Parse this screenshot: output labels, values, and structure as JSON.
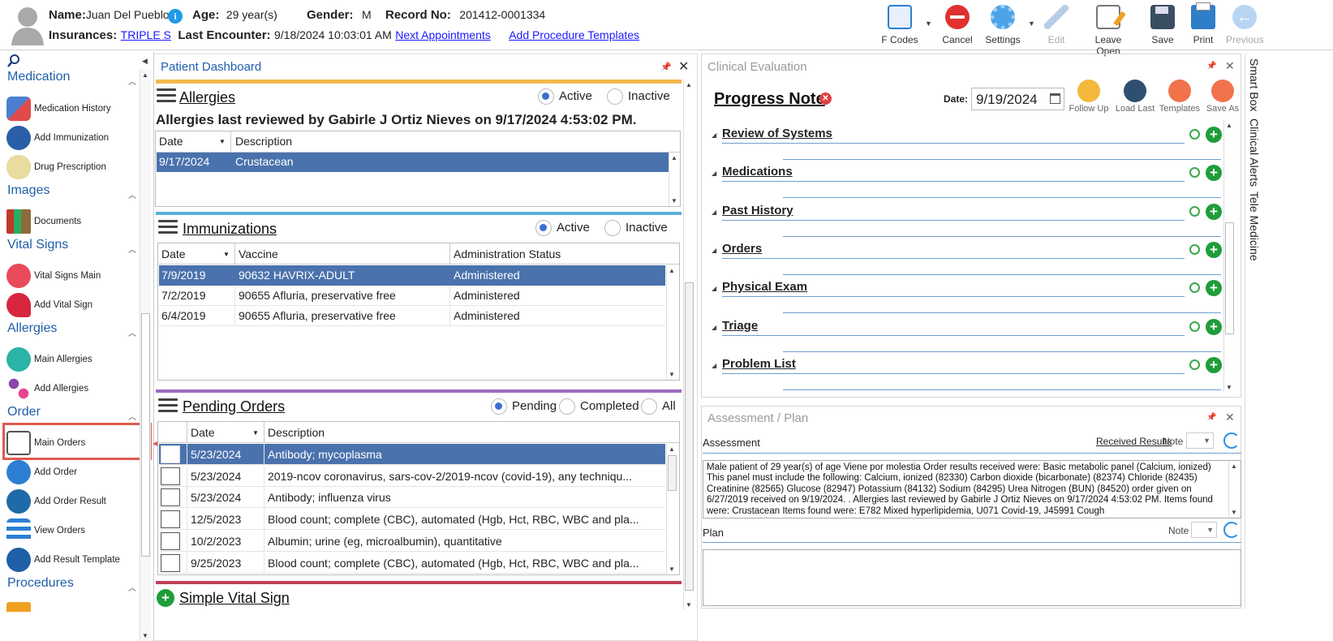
{
  "patient": {
    "name_label": "Name:",
    "name": "Juan Del Pueblo",
    "age_label": "Age:",
    "age": "29 year(s)",
    "gender_label": "Gender:",
    "gender": "M",
    "record_label": "Record No:",
    "record": "201412-0001334",
    "insurances_label": "Insurances:",
    "insurance": "TRIPLE S",
    "last_encounter_label": "Last Encounter:",
    "last_encounter": "9/18/2024 10:03:01 AM",
    "next_appointments": "Next Appointments",
    "add_procedure_templates": "Add Procedure Templates"
  },
  "toolbar": {
    "fcodes": "F Codes",
    "cancel": "Cancel",
    "settings": "Settings",
    "edit": "Edit",
    "leave_open": "Leave Open",
    "save": "Save",
    "print": "Print",
    "previous": "Previous"
  },
  "leftnav": {
    "medication": "Medication",
    "medication_history": "Medication History",
    "add_immunization": "Add Immunization",
    "drug_prescription": "Drug Prescription",
    "images": "Images",
    "documents": "Documents",
    "vital_signs": "Vital Signs",
    "vital_signs_main": "Vital Signs Main",
    "add_vital_sign": "Add Vital Sign",
    "allergies": "Allergies",
    "main_allergies": "Main Allergies",
    "add_allergies": "Add Allergies",
    "order": "Order",
    "main_orders": "Main Orders",
    "add_order": "Add Order",
    "add_order_result": "Add Order Result",
    "view_orders": "View Orders",
    "add_result_template": "Add Result Template",
    "procedures": "Procedures"
  },
  "dashboard": {
    "title": "Patient Dashboard",
    "allergies": {
      "title": "Allergies",
      "active": "Active",
      "inactive": "Inactive",
      "reviewed": "Allergies last reviewed by Gabirle J Ortiz Nieves on 9/17/2024 4:53:02 PM.",
      "col_date": "Date",
      "col_desc": "Description",
      "rows": [
        {
          "date": "9/17/2024",
          "desc": "Crustacean"
        }
      ]
    },
    "immunizations": {
      "title": "Immunizations",
      "active": "Active",
      "inactive": "Inactive",
      "col_date": "Date",
      "col_vaccine": "Vaccine",
      "col_status": "Administration Status",
      "rows": [
        {
          "date": "7/9/2019",
          "vaccine": "90632 HAVRIX-ADULT",
          "status": "Administered"
        },
        {
          "date": "7/2/2019",
          "vaccine": "90655 Afluria, preservative free",
          "status": "Administered"
        },
        {
          "date": "6/4/2019",
          "vaccine": "90655 Afluria, preservative free",
          "status": "Administered"
        }
      ]
    },
    "pending_orders": {
      "title": "Pending Orders",
      "pending": "Pending",
      "completed": "Completed",
      "all": "All",
      "col_date": "Date",
      "col_desc": "Description",
      "rows": [
        {
          "date": "5/23/2024",
          "desc": "Antibody; mycoplasma"
        },
        {
          "date": "5/23/2024",
          "desc": "2019-ncov coronavirus, sars-cov-2/2019-ncov (covid-19), any techniqu..."
        },
        {
          "date": "5/23/2024",
          "desc": "Antibody; influenza virus"
        },
        {
          "date": "12/5/2023",
          "desc": "Blood count; complete (CBC), automated (Hgb, Hct, RBC, WBC and pla..."
        },
        {
          "date": "10/2/2023",
          "desc": "Albumin; urine (eg, microalbumin), quantitative"
        },
        {
          "date": "9/25/2023",
          "desc": "Blood count; complete (CBC), automated (Hgb, Hct, RBC, WBC and pla..."
        }
      ]
    },
    "simple_vital_sign": "Simple Vital Sign"
  },
  "clinical": {
    "title": "Clinical Evaluation",
    "progress_note": "Progress Note",
    "date_label": "Date:",
    "date": "9/19/2024",
    "follow_up": "Follow Up",
    "load_last": "Load Last",
    "templates": "Templates",
    "save_as": "Save As",
    "items": [
      "Review of Systems",
      "Medications",
      "Past History",
      "Orders",
      "Physical Exam",
      "Triage",
      "Problem List"
    ]
  },
  "assessment": {
    "title": "Assessment / Plan",
    "assessment_label": "Assessment",
    "received_results": "Received Results",
    "note": "Note",
    "text": "Male patient of 29 year(s) of age Viene por molestia   Order results received were: Basic metabolic panel (Calcium, ionized) This panel must include the following: Calcium, ionized (82330) Carbon dioxide (bicarbonate) (82374) Chloride (82435) Creatinine (82565) Glucose (82947) Potassium (84132) Sodium (84295) Urea Nitrogen (BUN) (84520) order given on 6/27/2019 received on 9/19/2024. .  Allergies last reviewed by Gabirle J Ortiz Nieves on 9/17/2024 4:53:02 PM.    Items found were:  Crustacean  Items found were:  E782 Mixed hyperlipidemia, U071 Covid-19, J45991 Cough",
    "plan_label": "Plan",
    "plan_note": "Note"
  },
  "side_tabs": [
    "Smart Box",
    "Clinical Alerts",
    "Tele Medicine"
  ]
}
